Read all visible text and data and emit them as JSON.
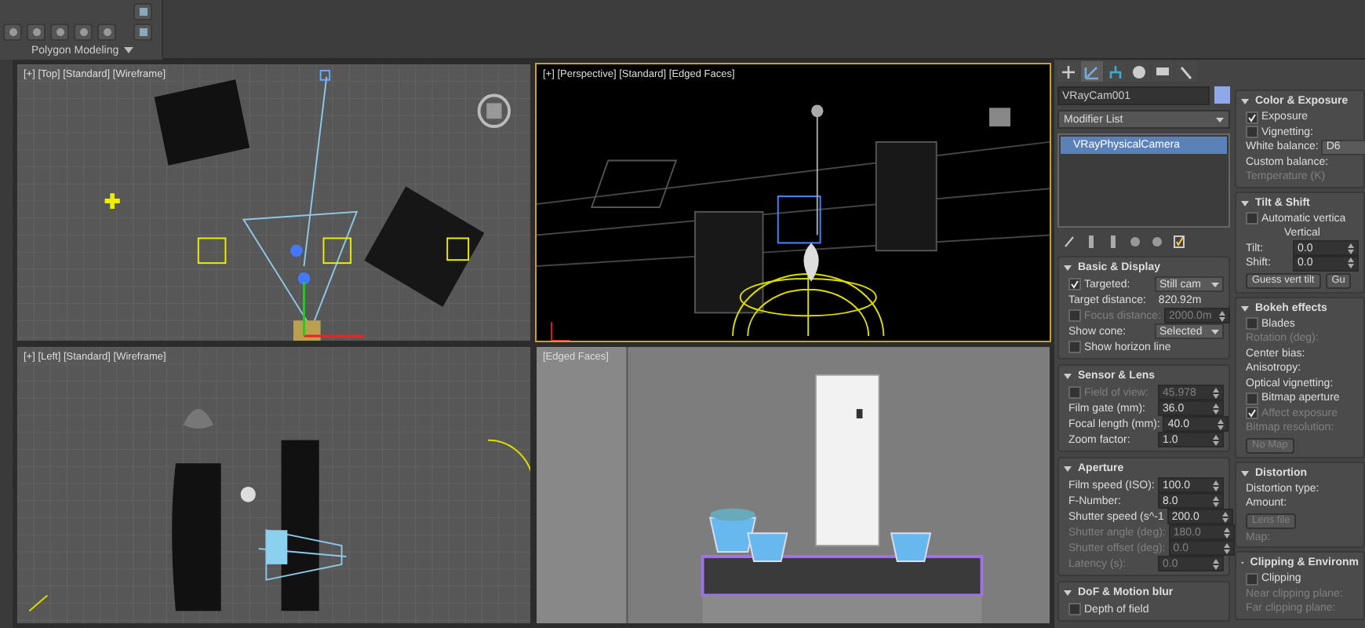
{
  "ribbon": {
    "panel_label": "Polygon Modeling"
  },
  "viewports": [
    {
      "label": "[+] [Top] [Standard] [Wireframe]",
      "kind": "top",
      "active": false
    },
    {
      "label": "[+] [Perspective] [Standard] [Edged Faces]",
      "kind": "perspective",
      "active": true
    },
    {
      "label": "[+] [Left] [Standard] [Wireframe]",
      "kind": "left",
      "active": false
    },
    {
      "label": "[Edged Faces]",
      "kind": "camera",
      "active": false
    }
  ],
  "command_panel": {
    "tabs": [
      {
        "kind": "create",
        "selected": false
      },
      {
        "kind": "modify",
        "selected": true
      },
      {
        "kind": "hierarchy",
        "selected": false
      },
      {
        "kind": "motion",
        "selected": false
      },
      {
        "kind": "display",
        "selected": false
      },
      {
        "kind": "utilities",
        "selected": false
      }
    ],
    "object_name": "VRayCam001",
    "modifier_list": "Modifier List",
    "stack": [
      {
        "label": "VRayPhysicalCamera",
        "selected": true
      }
    ],
    "rollouts_left": [
      {
        "title": "Basic & Display",
        "expanded": true,
        "rows": [
          {
            "kind": "check_dropdown",
            "label": "Targeted:",
            "checked": true,
            "value": "Still cam"
          },
          {
            "kind": "text",
            "label": "Target distance:",
            "value": "820.92m"
          },
          {
            "kind": "check_spinner",
            "label": "Focus distance:",
            "checked": false,
            "value": "2000.0m",
            "disabled": true
          },
          {
            "kind": "dropdown",
            "label": "Show cone:",
            "value": "Selected"
          },
          {
            "kind": "check",
            "label": "Show horizon line",
            "checked": false
          }
        ]
      },
      {
        "title": "Sensor & Lens",
        "expanded": true,
        "rows": [
          {
            "kind": "check_spinner",
            "label": "Field of view:",
            "checked": false,
            "value": "45.978",
            "disabled": true
          },
          {
            "kind": "spinner",
            "label": "Film gate (mm):",
            "value": "36.0"
          },
          {
            "kind": "spinner",
            "label": "Focal length (mm):",
            "value": "40.0"
          },
          {
            "kind": "spinner",
            "label": "Zoom factor:",
            "value": "1.0"
          }
        ]
      },
      {
        "title": "Aperture",
        "expanded": true,
        "rows": [
          {
            "kind": "spinner",
            "label": "Film speed (ISO):",
            "value": "100.0"
          },
          {
            "kind": "spinner",
            "label": "F-Number:",
            "value": "8.0"
          },
          {
            "kind": "spinner",
            "label": "Shutter speed (s^-1",
            "value": "200.0"
          },
          {
            "kind": "spinner",
            "label": "Shutter angle (deg):",
            "value": "180.0",
            "disabled": true
          },
          {
            "kind": "spinner",
            "label": "Shutter offset (deg):",
            "value": "0.0",
            "disabled": true
          },
          {
            "kind": "spinner",
            "label": "Latency (s):",
            "value": "0.0",
            "disabled": true
          }
        ]
      },
      {
        "title": "DoF & Motion blur",
        "expanded": true,
        "rows": [
          {
            "kind": "check",
            "label": "Depth of field",
            "checked": false
          }
        ]
      }
    ],
    "rollouts_right": [
      {
        "title": "Color & Exposure",
        "expanded": true,
        "rows": [
          {
            "kind": "check",
            "label": "Exposure",
            "checked": true
          },
          {
            "kind": "check",
            "label": "Vignetting:",
            "checked": false
          },
          {
            "kind": "dropdown",
            "label": "White balance:",
            "value": "D6"
          },
          {
            "kind": "text",
            "label": "Custom balance:"
          },
          {
            "kind": "text",
            "label": "Temperature (K)",
            "disabled": true
          }
        ]
      },
      {
        "title": "Tilt & Shift",
        "expanded": true,
        "rows": [
          {
            "kind": "check",
            "label": "Automatic vertica",
            "checked": false
          },
          {
            "kind": "caption",
            "label": "Vertical"
          },
          {
            "kind": "spinner",
            "label": "Tilt:",
            "value": "0.0"
          },
          {
            "kind": "spinner",
            "label": "Shift:",
            "value": "0.0"
          },
          {
            "kind": "buttons",
            "labels": [
              "Guess vert tilt",
              "Gu"
            ]
          }
        ]
      },
      {
        "title": "Bokeh effects",
        "expanded": true,
        "rows": [
          {
            "kind": "check",
            "label": "Blades",
            "checked": false
          },
          {
            "kind": "text",
            "label": "Rotation (deg):",
            "disabled": true
          },
          {
            "kind": "text",
            "label": "Center bias:"
          },
          {
            "kind": "text",
            "label": "Anisotropy:"
          },
          {
            "kind": "text",
            "label": "Optical vignetting:"
          },
          {
            "kind": "check",
            "label": "Bitmap aperture",
            "checked": false
          },
          {
            "kind": "check",
            "label": "Affect exposure",
            "checked": true,
            "disabled": true
          },
          {
            "kind": "text",
            "label": "Bitmap resolution:",
            "disabled": true
          },
          {
            "kind": "buttons",
            "labels": [
              "No Map"
            ],
            "disabled": true
          }
        ]
      },
      {
        "title": "Distortion",
        "expanded": true,
        "rows": [
          {
            "kind": "text",
            "label": "Distortion type:"
          },
          {
            "kind": "text",
            "label": "Amount:"
          },
          {
            "kind": "buttons",
            "labels": [
              "Lens file"
            ],
            "disabled": true
          },
          {
            "kind": "text",
            "label": "Map:",
            "disabled": true
          }
        ]
      },
      {
        "title": "Clipping & Environm",
        "expanded": true,
        "rows": [
          {
            "kind": "check",
            "label": "Clipping",
            "checked": false
          },
          {
            "kind": "text",
            "label": "Near clipping plane:",
            "disabled": true
          },
          {
            "kind": "text",
            "label": "Far clipping plane:",
            "disabled": true
          }
        ]
      }
    ]
  }
}
